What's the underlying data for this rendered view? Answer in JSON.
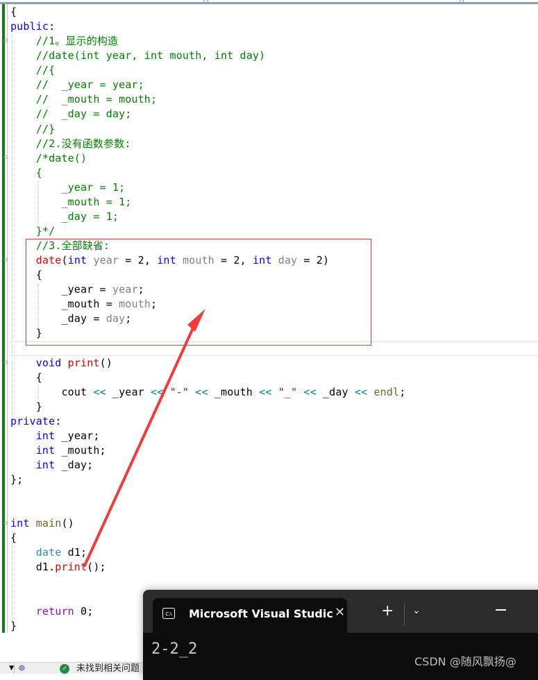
{
  "code_lines": [
    [
      {
        "t": "{",
        "c": ""
      }
    ],
    [
      {
        "t": "public",
        "c": "kw"
      },
      {
        "t": ":",
        "c": ""
      }
    ],
    [
      {
        "t": "    //1。显示的构造",
        "c": "cm"
      }
    ],
    [
      {
        "t": "    //date(int year, int mouth, int day)",
        "c": "cm"
      }
    ],
    [
      {
        "t": "    //{",
        "c": "cm"
      }
    ],
    [
      {
        "t": "    //  _year = year;",
        "c": "cm"
      }
    ],
    [
      {
        "t": "    //  _mouth = mouth;",
        "c": "cm"
      }
    ],
    [
      {
        "t": "    //  _day = day;",
        "c": "cm"
      }
    ],
    [
      {
        "t": "    //}",
        "c": "cm"
      }
    ],
    [
      {
        "t": "    //2.没有函数参数:",
        "c": "cm"
      }
    ],
    [
      {
        "t": "    /*date()",
        "c": "cm"
      }
    ],
    [
      {
        "t": "    {",
        "c": "cm"
      }
    ],
    [
      {
        "t": "        _year = 1;",
        "c": "cm"
      }
    ],
    [
      {
        "t": "        _mouth = 1;",
        "c": "cm"
      }
    ],
    [
      {
        "t": "        _day = 1;",
        "c": "cm"
      }
    ],
    [
      {
        "t": "    }*/",
        "c": "cm"
      }
    ],
    [
      {
        "t": "    //3.全部缺省:",
        "c": "cm"
      }
    ],
    [
      {
        "t": "    ",
        "c": ""
      },
      {
        "t": "date",
        "c": "fn"
      },
      {
        "t": "(",
        "c": ""
      },
      {
        "t": "int",
        "c": "kw"
      },
      {
        "t": " ",
        "c": ""
      },
      {
        "t": "year",
        "c": "pm"
      },
      {
        "t": " = 2, ",
        "c": ""
      },
      {
        "t": "int",
        "c": "kw"
      },
      {
        "t": " ",
        "c": ""
      },
      {
        "t": "mouth",
        "c": "pm"
      },
      {
        "t": " = 2, ",
        "c": ""
      },
      {
        "t": "int",
        "c": "kw"
      },
      {
        "t": " ",
        "c": ""
      },
      {
        "t": "day",
        "c": "pm"
      },
      {
        "t": " = 2)",
        "c": ""
      }
    ],
    [
      {
        "t": "    {",
        "c": ""
      }
    ],
    [
      {
        "t": "        _year = ",
        "c": ""
      },
      {
        "t": "year",
        "c": "pm"
      },
      {
        "t": ";",
        "c": ""
      }
    ],
    [
      {
        "t": "        _mouth = ",
        "c": ""
      },
      {
        "t": "mouth",
        "c": "pm"
      },
      {
        "t": ";",
        "c": ""
      }
    ],
    [
      {
        "t": "        _day = ",
        "c": ""
      },
      {
        "t": "day",
        "c": "pm"
      },
      {
        "t": ";",
        "c": ""
      }
    ],
    [
      {
        "t": "    }",
        "c": ""
      }
    ],
    [
      {
        "t": "",
        "c": ""
      }
    ],
    [
      {
        "t": "    ",
        "c": ""
      },
      {
        "t": "void",
        "c": "kw"
      },
      {
        "t": " ",
        "c": ""
      },
      {
        "t": "print",
        "c": "fn"
      },
      {
        "t": "()",
        "c": ""
      }
    ],
    [
      {
        "t": "    {",
        "c": ""
      }
    ],
    [
      {
        "t": "        cout ",
        "c": ""
      },
      {
        "t": "<<",
        "c": "op"
      },
      {
        "t": " _year ",
        "c": ""
      },
      {
        "t": "<<",
        "c": "op"
      },
      {
        "t": " ",
        "c": ""
      },
      {
        "t": "\"-\"",
        "c": "st"
      },
      {
        "t": " ",
        "c": ""
      },
      {
        "t": "<<",
        "c": "op"
      },
      {
        "t": " _mouth ",
        "c": ""
      },
      {
        "t": "<<",
        "c": "op"
      },
      {
        "t": " ",
        "c": ""
      },
      {
        "t": "\"_\"",
        "c": "st"
      },
      {
        "t": " ",
        "c": ""
      },
      {
        "t": "<<",
        "c": "op"
      },
      {
        "t": " _day ",
        "c": ""
      },
      {
        "t": "<<",
        "c": "op"
      },
      {
        "t": " ",
        "c": ""
      },
      {
        "t": "endl",
        "c": "en"
      },
      {
        "t": ";",
        "c": ""
      }
    ],
    [
      {
        "t": "    }",
        "c": ""
      }
    ],
    [
      {
        "t": "private",
        "c": "kw"
      },
      {
        "t": ":",
        "c": ""
      }
    ],
    [
      {
        "t": "    ",
        "c": ""
      },
      {
        "t": "int",
        "c": "kw"
      },
      {
        "t": " _year;",
        "c": ""
      }
    ],
    [
      {
        "t": "    ",
        "c": ""
      },
      {
        "t": "int",
        "c": "kw"
      },
      {
        "t": " _mouth;",
        "c": ""
      }
    ],
    [
      {
        "t": "    ",
        "c": ""
      },
      {
        "t": "int",
        "c": "kw"
      },
      {
        "t": " _day;",
        "c": ""
      }
    ],
    [
      {
        "t": "};",
        "c": ""
      }
    ],
    [
      {
        "t": "",
        "c": ""
      }
    ],
    [
      {
        "t": "",
        "c": ""
      }
    ],
    [
      {
        "t": "int",
        "c": "kw"
      },
      {
        "t": " ",
        "c": ""
      },
      {
        "t": "main",
        "c": "en"
      },
      {
        "t": "()",
        "c": ""
      }
    ],
    [
      {
        "t": "{",
        "c": ""
      }
    ],
    [
      {
        "t": "    ",
        "c": ""
      },
      {
        "t": "date",
        "c": "ty"
      },
      {
        "t": " d1;",
        "c": ""
      }
    ],
    [
      {
        "t": "    d1.",
        "c": ""
      },
      {
        "t": "print",
        "c": "fn"
      },
      {
        "t": "();",
        "c": ""
      }
    ],
    [
      {
        "t": "",
        "c": ""
      }
    ],
    [
      {
        "t": "",
        "c": ""
      }
    ],
    [
      {
        "t": "    ",
        "c": ""
      },
      {
        "t": "return",
        "c": "ret"
      },
      {
        "t": " 0;",
        "c": ""
      }
    ],
    [
      {
        "t": "}",
        "c": ""
      }
    ]
  ],
  "annotation": {
    "color": "#e33c3c"
  },
  "terminal": {
    "tab_title": "Microsoft Visual Studic",
    "tab_icon": "C:\\",
    "close_glyph": "✕",
    "new_tab_glyph": "+",
    "dropdown_glyph": "⌄",
    "output": "2-2_2",
    "watermark": "CSDN @随风飘扬@"
  },
  "statusbar": {
    "dropdown_glyph": "▼",
    "ai_glyph": "☸",
    "ok_glyph": "✓",
    "message": "未找到相关问题"
  }
}
